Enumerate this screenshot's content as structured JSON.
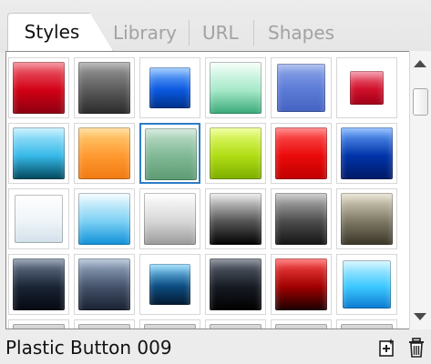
{
  "tabs": [
    {
      "label": "Styles",
      "active": true
    },
    {
      "label": "Library",
      "active": false
    },
    {
      "label": "URL",
      "active": false
    },
    {
      "label": "Shapes",
      "active": false
    }
  ],
  "gallery": {
    "columns": 6,
    "selected_name": "Plastic Button 009",
    "rows": [
      [
        {
          "style": "glossy-red",
          "colors": [
            "#f06a78",
            "#d10015",
            "#8a0010"
          ]
        },
        {
          "style": "glossy-dark-gray",
          "colors": [
            "#9c9c9c",
            "#5a5a5a",
            "#2a2a2a"
          ]
        },
        {
          "style": "beveled-blue",
          "colors": [
            "#7db8ff",
            "#0a58e0",
            "#00318a"
          ]
        },
        {
          "style": "mint-glow",
          "colors": [
            "#f4fff9",
            "#a6e8c9",
            "#38a878"
          ]
        },
        {
          "style": "soft-blue",
          "colors": [
            "#8da6e8",
            "#5b7ad6",
            "#4563c0"
          ]
        },
        {
          "style": "red-small-gem",
          "colors": [
            "#f0758a",
            "#d0102a",
            "#a00018"
          ]
        }
      ],
      [
        {
          "style": "cyan-horizon",
          "colors": [
            "#b6ecff",
            "#37b9e8",
            "#00465a"
          ]
        },
        {
          "style": "orange-glow",
          "colors": [
            "#ffd27a",
            "#ff9930",
            "#f07a12"
          ]
        },
        {
          "style": "sage-green",
          "colors": [
            "#c3e2cf",
            "#7fb793",
            "#5c9b74"
          ]
        },
        {
          "style": "lime-green",
          "colors": [
            "#e9ff7e",
            "#b0dc14",
            "#7dae00"
          ]
        },
        {
          "style": "bright-red",
          "colors": [
            "#ff5a5a",
            "#ea0a0a",
            "#c00000"
          ]
        },
        {
          "style": "navy-blue",
          "colors": [
            "#6aa7ff",
            "#0033a8",
            "#001a66"
          ]
        }
      ],
      [
        {
          "style": "white-soft",
          "colors": [
            "#ffffff",
            "#eef4f8",
            "#d2e0ea"
          ]
        },
        {
          "style": "sky-blue-gradient",
          "colors": [
            "#f0fbff",
            "#7cd0f4",
            "#0f90d8"
          ]
        },
        {
          "style": "silver-gradient",
          "colors": [
            "#ffffff",
            "#d6d6d6",
            "#9a9a9a"
          ]
        },
        {
          "style": "black-chrome",
          "colors": [
            "#e8e8e8",
            "#555555",
            "#000000"
          ]
        },
        {
          "style": "gunmetal-chrome",
          "colors": [
            "#bcbcbc",
            "#4c4c4c",
            "#141414"
          ]
        },
        {
          "style": "bronze-chrome",
          "colors": [
            "#e2dcc8",
            "#7d7864",
            "#3a3628"
          ]
        }
      ],
      [
        {
          "style": "dark-navy-glass",
          "colors": [
            "#6e7e96",
            "#1a2434",
            "#050912"
          ]
        },
        {
          "style": "slate-glass",
          "colors": [
            "#9eb2cc",
            "#44526a",
            "#1a2232"
          ]
        },
        {
          "style": "blue-ring-glow",
          "colors": [
            "#7fd4ff",
            "#0c4c80",
            "#041a30"
          ]
        },
        {
          "style": "black-glass",
          "colors": [
            "#606876",
            "#161a22",
            "#000000"
          ]
        },
        {
          "style": "red-black-chrome",
          "colors": [
            "#ff4a4a",
            "#a00000",
            "#1a0000"
          ]
        },
        {
          "style": "aqua-glass",
          "colors": [
            "#c8f4ff",
            "#3cc8ff",
            "#0a7ad0"
          ]
        }
      ],
      [
        {
          "style": "partial-1",
          "colors": [
            "#cccccc",
            "#999999",
            "#666666"
          ]
        },
        {
          "style": "partial-2",
          "colors": [
            "#cccccc",
            "#999999",
            "#666666"
          ]
        },
        {
          "style": "partial-3",
          "colors": [
            "#cccccc",
            "#999999",
            "#666666"
          ]
        },
        {
          "style": "partial-4",
          "colors": [
            "#cccccc",
            "#999999",
            "#666666"
          ]
        },
        {
          "style": "partial-5",
          "colors": [
            "#cccccc",
            "#999999",
            "#666666"
          ]
        },
        {
          "style": "partial-6",
          "colors": [
            "#cccccc",
            "#999999",
            "#666666"
          ]
        }
      ]
    ],
    "selected_cell": {
      "row": 1,
      "col": 2
    }
  },
  "scrollbar": {
    "up_icon": "triangle-up-icon",
    "down_icon": "triangle-down-icon"
  },
  "status": {
    "label": "Plastic Button 009",
    "actions": [
      {
        "name": "new-style-icon",
        "title": "New style"
      },
      {
        "name": "trash-icon",
        "title": "Delete style"
      }
    ]
  }
}
